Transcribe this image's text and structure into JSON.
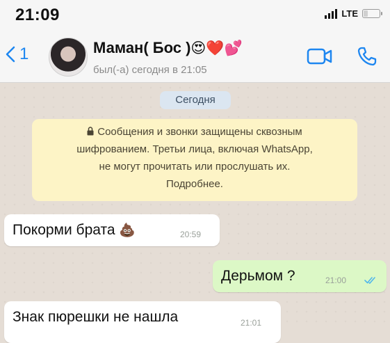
{
  "status_bar": {
    "time": "21:09",
    "network": "LTE",
    "signal_bars": 4,
    "battery_level": 0.25
  },
  "header": {
    "back_label": "1",
    "contact_name": "Маман( Бос )",
    "name_emoji": "😍❤️💕",
    "last_seen": "был(-а) сегодня в 21:05",
    "icons": [
      "chevron-left-icon",
      "video-call-icon",
      "phone-icon"
    ],
    "accent_color": "#1d86f0"
  },
  "chat": {
    "date_label": "Сегодня",
    "encryption_notice": {
      "line1": "Сообщения и звонки защищены сквозным",
      "line2": "шифрованием. Третьи лица, включая WhatsApp,",
      "line3": "не могут прочитать или прослушать их.",
      "line4": "Подробнее."
    },
    "messages": [
      {
        "direction": "incoming",
        "text": "Покорми брата",
        "emoji": "💩",
        "time": "20:59"
      },
      {
        "direction": "outgoing",
        "text": "Дерьмом ?",
        "time": "21:00",
        "status": "read"
      },
      {
        "direction": "incoming",
        "text": "Знак пюрешки не нашла",
        "time": "21:01"
      }
    ]
  }
}
